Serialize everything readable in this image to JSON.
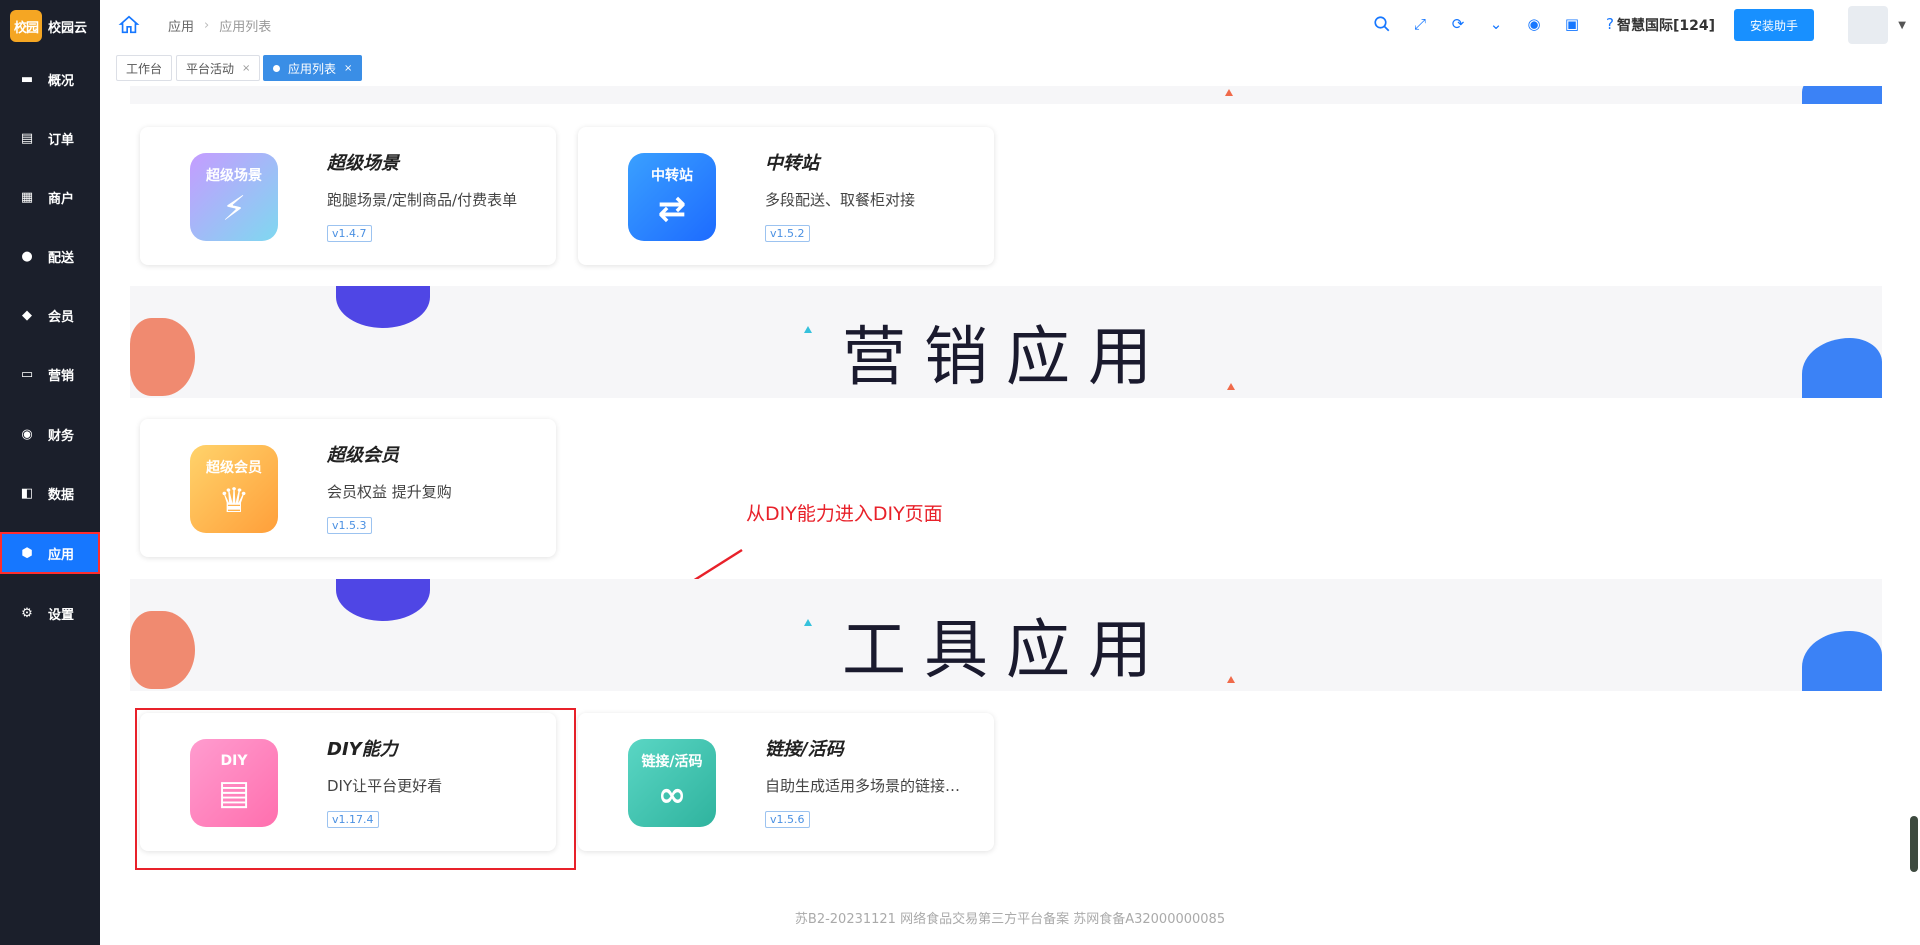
{
  "sidebar": {
    "logo_badge": "校园",
    "logo_text": "校园云",
    "items": [
      {
        "label": "概况",
        "icon": "monitor-icon"
      },
      {
        "label": "订单",
        "icon": "order-icon"
      },
      {
        "label": "商户",
        "icon": "store-icon"
      },
      {
        "label": "配送",
        "icon": "delivery-icon"
      },
      {
        "label": "会员",
        "icon": "diamond-icon"
      },
      {
        "label": "营销",
        "icon": "ticket-icon"
      },
      {
        "label": "财务",
        "icon": "moneybag-icon"
      },
      {
        "label": "数据",
        "icon": "chart-icon"
      },
      {
        "label": "应用",
        "icon": "cube-icon"
      },
      {
        "label": "设置",
        "icon": "gear-icon"
      }
    ],
    "active_index": 8
  },
  "header": {
    "breadcrumb": [
      "应用",
      "应用列表"
    ],
    "account": "智慧国际[124]",
    "install_button": "安装助手"
  },
  "tabs": [
    {
      "label": "工作台",
      "closable": false
    },
    {
      "label": "平台活动",
      "closable": true
    },
    {
      "label": "应用列表",
      "closable": true,
      "active": true
    }
  ],
  "tab_close": "×",
  "sections": {
    "marketing_title": "营销应用",
    "tools_title": "工具应用"
  },
  "cards": {
    "super_scene": {
      "icon_text": "超级场景",
      "name": "超级场景",
      "desc": "跑腿场景/定制商品/付费表单",
      "version": "v1.4.7"
    },
    "transfer": {
      "icon_text": "中转站",
      "name": "中转站",
      "desc": "多段配送、取餐柜对接",
      "version": "v1.5.2"
    },
    "super_member": {
      "icon_text": "超级会员",
      "name": "超级会员",
      "desc": "会员权益 提升复购",
      "version": "v1.5.3"
    },
    "diy": {
      "icon_text": "DIY",
      "name": "DIY能力",
      "desc": "DIY让平台更好看",
      "version": "v1.17.4"
    },
    "link_code": {
      "icon_text": "链接/活码",
      "name": "链接/活码",
      "desc": "自助生成适用多场景的链接与活码",
      "version": "v1.5.6"
    }
  },
  "annotation": "从DIY能力进入DIY页面",
  "footer": "苏B2-20231121   网络食品交易第三方平台备案 苏网食备A32000000085",
  "colors": {
    "accent": "#1677ff",
    "sidebar_bg": "#1b1f2b",
    "annotation": "#e8212a"
  }
}
